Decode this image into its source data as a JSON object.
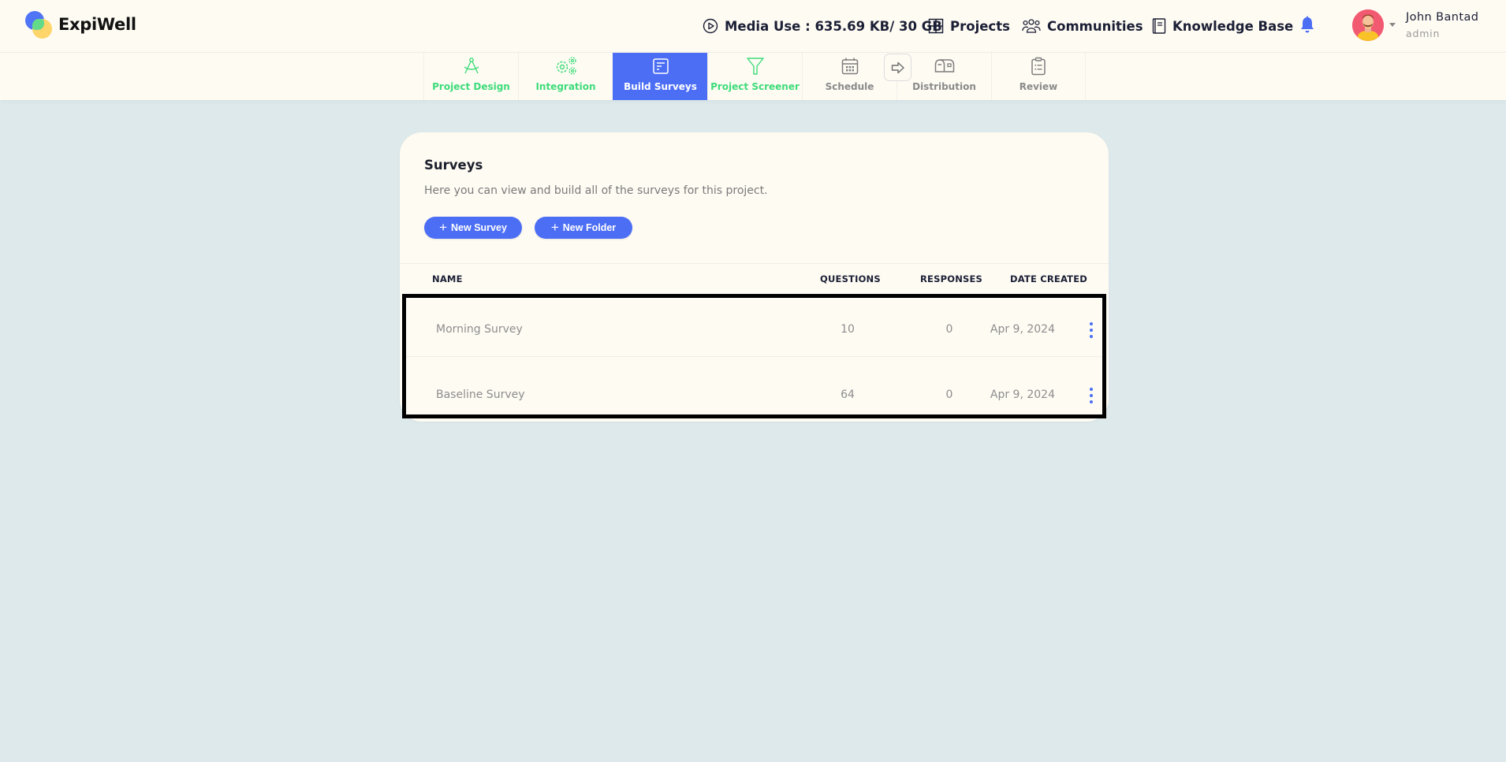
{
  "header": {
    "brand": "ExpiWell",
    "media_use": "Media Use : 635.69 KB/ 30 GB",
    "nav": [
      {
        "label": "Projects",
        "icon": "grid-icon"
      },
      {
        "label": "Communities",
        "icon": "users-icon"
      },
      {
        "label": "Knowledge Base",
        "icon": "book-icon"
      }
    ],
    "notifications_icon": "bell-icon",
    "user": {
      "name": "John Bantad",
      "role": "admin"
    }
  },
  "steps": [
    {
      "label": "Project Design",
      "icon": "compass-icon",
      "state": "done"
    },
    {
      "label": "Integration",
      "icon": "gears-icon",
      "state": "done"
    },
    {
      "label": "Build Surveys",
      "icon": "survey-icon",
      "state": "active"
    },
    {
      "label": "Project Screener",
      "icon": "filter-icon",
      "state": "done"
    },
    {
      "label": "Schedule",
      "icon": "calendar-icon",
      "state": "pending"
    },
    {
      "label": "Distribution",
      "icon": "mailbox-icon",
      "state": "pending"
    },
    {
      "label": "Review",
      "icon": "clipboard-icon",
      "state": "pending"
    }
  ],
  "colors": {
    "accent": "#4c6ef5",
    "done": "#3ddc7a",
    "pending": "#8a8a8a",
    "background": "#dde9ea",
    "surface": "#fefbf3"
  },
  "surveys": {
    "title": "Surveys",
    "subtitle": "Here you can view and build all of the surveys for this project.",
    "new_survey_label": "New Survey",
    "new_folder_label": "New Folder",
    "columns": {
      "name": "NAME",
      "questions": "QUESTIONS",
      "responses": "RESPONSES",
      "date_created": "DATE CREATED"
    },
    "rows": [
      {
        "name": "Morning Survey",
        "questions": "10",
        "responses": "0",
        "date_created": "Apr 9, 2024"
      },
      {
        "name": "Baseline Survey",
        "questions": "64",
        "responses": "0",
        "date_created": "Apr 9, 2024"
      }
    ]
  }
}
